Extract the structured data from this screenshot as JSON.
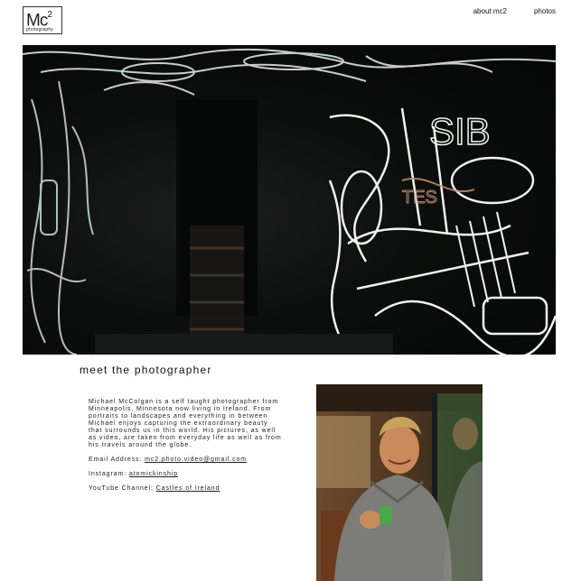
{
  "logo": {
    "mark": "Mc",
    "superscript": "2",
    "subtitle": "photography"
  },
  "nav": {
    "items": [
      "about mc2",
      "photos"
    ]
  },
  "hero": {
    "alt": "neon signs installation"
  },
  "section": {
    "heading": "meet the photographer"
  },
  "bio": {
    "paragraph": "Michael McColgan is a self taught photographer from Minneapolis, Minnesota now living in Ireland. From portraits to landscapes and everything in between Michael enjoys capturing the extraordinary beauty that surrounds us in this world. His pictures, as well as video, are taken from everyday life as well as from his travels around the globe.",
    "email_label": "Email Address: ",
    "email": "mc2.photo.video@gmail.com",
    "instagram_label": "Instagram: ",
    "instagram": "atomickinship",
    "youtube_label": "YouTube Channel: ",
    "youtube": "Castles of Ireland"
  },
  "colors": {
    "neon": "#e6efe9",
    "background": "#ffffff",
    "text": "#222222"
  }
}
